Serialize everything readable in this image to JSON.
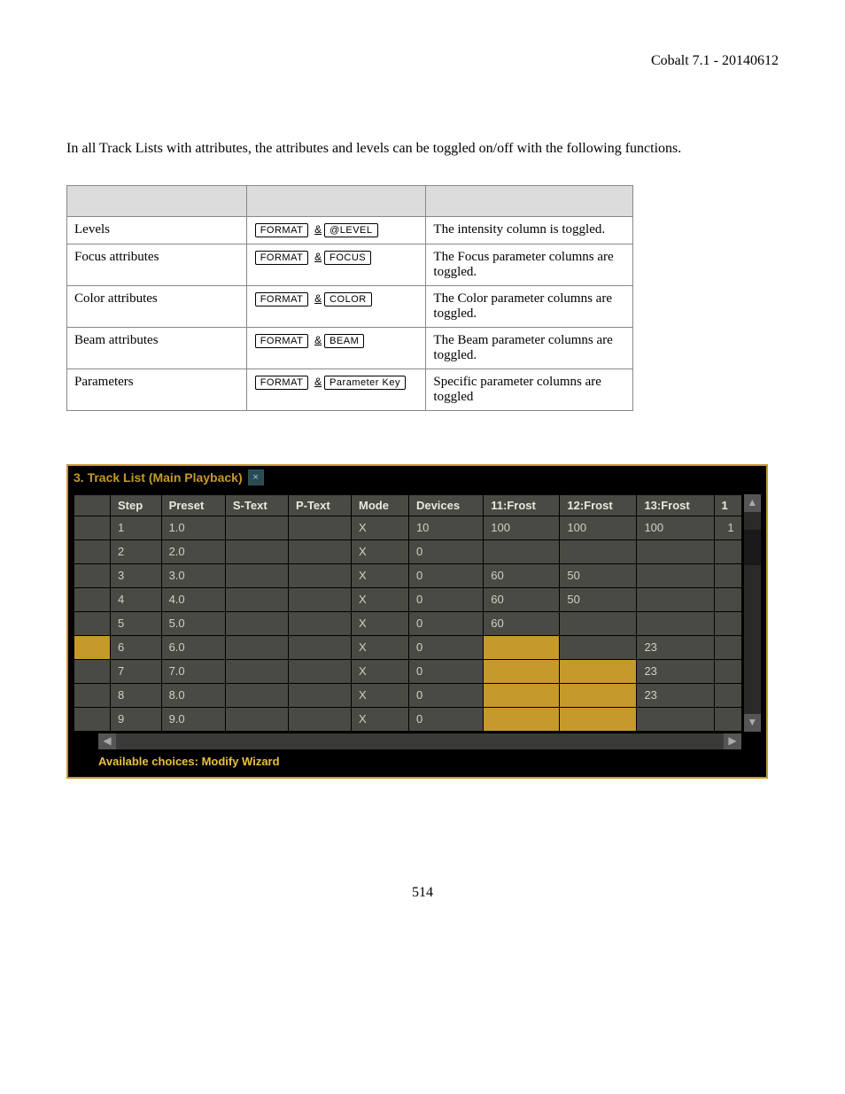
{
  "header": {
    "product": "Cobalt 7.1 - 20140612"
  },
  "intro_text": "In all Track Lists with attributes, the attributes and levels can be toggled on/off with the following functions.",
  "ref_table": {
    "rows": [
      {
        "name": "Levels",
        "keys": [
          "FORMAT",
          "&",
          "@LEVEL"
        ],
        "desc": "The intensity column is toggled."
      },
      {
        "name": "Focus attributes",
        "keys": [
          "FORMAT",
          "&",
          "FOCUS"
        ],
        "desc": "The Focus parameter columns are toggled."
      },
      {
        "name": "Color attributes",
        "keys": [
          "FORMAT",
          "&",
          "COLOR"
        ],
        "desc": "The Color parameter columns are toggled."
      },
      {
        "name": "Beam attributes",
        "keys": [
          "FORMAT",
          "&",
          "BEAM"
        ],
        "desc": "The Beam parameter columns are toggled."
      },
      {
        "name": "Parameters",
        "keys": [
          "FORMAT",
          "&",
          "Parameter Key"
        ],
        "desc": "Specific parameter columns are toggled"
      }
    ]
  },
  "tracklist": {
    "title": "3. Track List (Main Playback)",
    "columns": [
      "Step",
      "Preset",
      "S-Text",
      "P-Text",
      "Mode",
      "Devices",
      "11:Frost",
      "12:Frost",
      "13:Frost"
    ],
    "cut_col": "1",
    "rows": [
      {
        "step": "1",
        "preset": "1.0",
        "mode": "X",
        "devices": "10",
        "c11": "100",
        "c12": "100",
        "c13": "100",
        "last": "1",
        "sel": false,
        "o11": false,
        "o12": false
      },
      {
        "step": "2",
        "preset": "2.0",
        "mode": "X",
        "devices": "0",
        "c11": "",
        "c12": "",
        "c13": "",
        "last": "",
        "sel": false,
        "o11": false,
        "o12": false
      },
      {
        "step": "3",
        "preset": "3.0",
        "mode": "X",
        "devices": "0",
        "c11": "60",
        "c12": "50",
        "c13": "",
        "last": "",
        "sel": false,
        "o11": false,
        "o12": false
      },
      {
        "step": "4",
        "preset": "4.0",
        "mode": "X",
        "devices": "0",
        "c11": "60",
        "c12": "50",
        "c13": "",
        "last": "",
        "sel": false,
        "o11": false,
        "o12": false
      },
      {
        "step": "5",
        "preset": "5.0",
        "mode": "X",
        "devices": "0",
        "c11": "60",
        "c12": "",
        "c13": "",
        "last": "",
        "sel": false,
        "o11": false,
        "o12": false
      },
      {
        "step": "6",
        "preset": "6.0",
        "mode": "X",
        "devices": "0",
        "c11": "",
        "c12": "",
        "c13": "23",
        "last": "",
        "sel": true,
        "o11": true,
        "o12": false
      },
      {
        "step": "7",
        "preset": "7.0",
        "mode": "X",
        "devices": "0",
        "c11": "",
        "c12": "",
        "c13": "23",
        "last": "",
        "sel": false,
        "o11": true,
        "o12": true
      },
      {
        "step": "8",
        "preset": "8.0",
        "mode": "X",
        "devices": "0",
        "c11": "",
        "c12": "",
        "c13": "23",
        "last": "",
        "sel": false,
        "o11": true,
        "o12": true
      },
      {
        "step": "9",
        "preset": "9.0",
        "mode": "X",
        "devices": "0",
        "c11": "",
        "c12": "",
        "c13": "",
        "last": "",
        "sel": false,
        "o11": true,
        "o12": true
      }
    ],
    "footer": "Available choices: Modify Wizard"
  },
  "page_number": "514"
}
